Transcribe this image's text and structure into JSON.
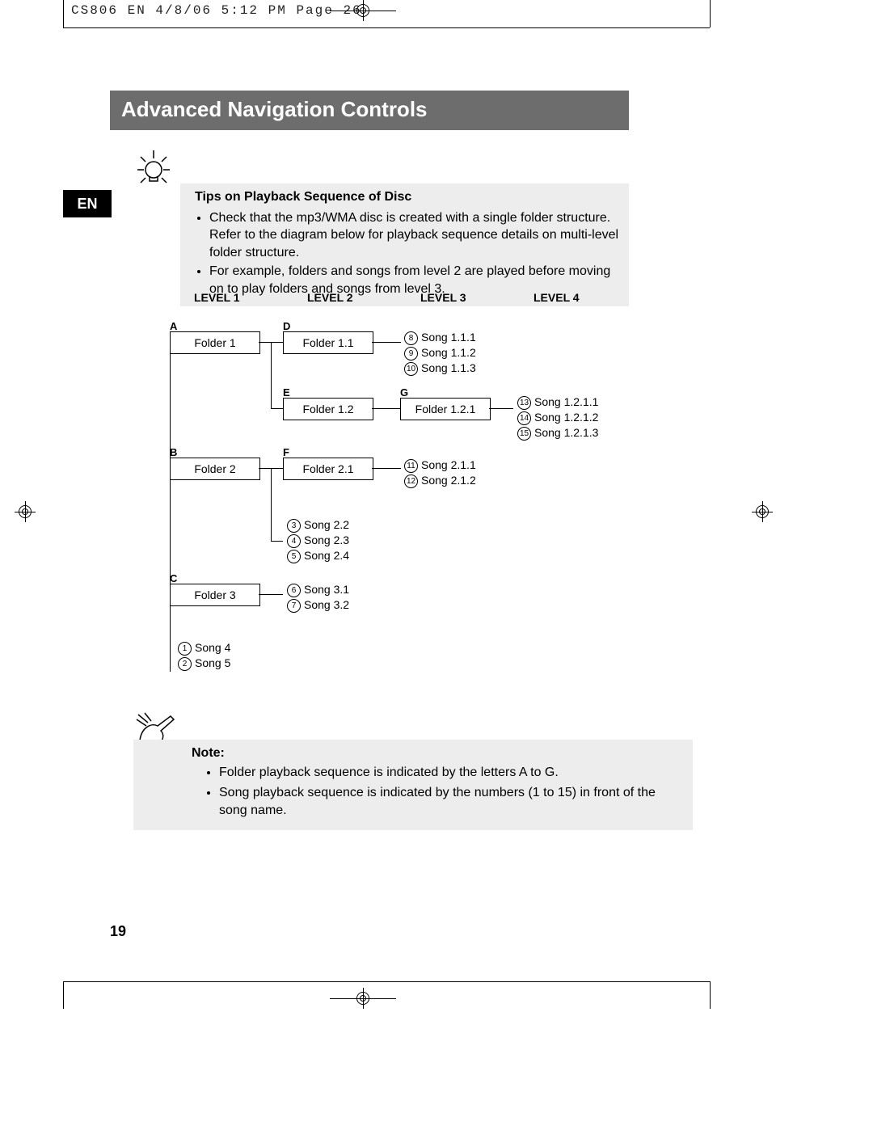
{
  "slug": "CS806 EN  4/8/06  5:12 PM  Page 26",
  "banner": "Advanced Navigation Controls",
  "lang": "EN",
  "tips": {
    "title": "Tips on Playback Sequence of Disc",
    "items": [
      "Check that the mp3/WMA disc is created with a single folder structure. Refer to the diagram below for playback sequence details on multi-level folder structure.",
      "For example, folders and songs from level 2 are played before moving on to play folders and songs from level 3."
    ]
  },
  "levels": [
    "LEVEL 1",
    "LEVEL 2",
    "LEVEL 3",
    "LEVEL 4"
  ],
  "folders": {
    "A": "Folder 1",
    "B": "Folder 2",
    "C": "Folder 3",
    "D": "Folder 1.1",
    "E": "Folder 1.2",
    "F": "Folder 2.1",
    "G": "Folder 1.2.1"
  },
  "songs": {
    "s111": {
      "n": "8",
      "t": "Song 1.1.1"
    },
    "s112": {
      "n": "9",
      "t": "Song 1.1.2"
    },
    "s113": {
      "n": "10",
      "t": "Song 1.1.3"
    },
    "s1211": {
      "n": "13",
      "t": "Song 1.2.1.1"
    },
    "s1212": {
      "n": "14",
      "t": "Song 1.2.1.2"
    },
    "s1213": {
      "n": "15",
      "t": "Song 1.2.1.3"
    },
    "s211": {
      "n": "11",
      "t": "Song 2.1.1"
    },
    "s212": {
      "n": "12",
      "t": "Song 2.1.2"
    },
    "s22": {
      "n": "3",
      "t": "Song 2.2"
    },
    "s23": {
      "n": "4",
      "t": "Song 2.3"
    },
    "s24": {
      "n": "5",
      "t": "Song 2.4"
    },
    "s31": {
      "n": "6",
      "t": "Song 3.1"
    },
    "s32": {
      "n": "7",
      "t": "Song 3.2"
    },
    "s4": {
      "n": "1",
      "t": "Song 4"
    },
    "s5": {
      "n": "2",
      "t": "Song 5"
    }
  },
  "note": {
    "title": "Note:",
    "items": [
      "Folder playback sequence is indicated by the letters A to G.",
      "Song playback sequence is indicated by the numbers (1 to 15) in front of the song name."
    ]
  },
  "page_number": "19",
  "flabels": {
    "A": "A",
    "B": "B",
    "C": "C",
    "D": "D",
    "E": "E",
    "F": "F",
    "G": "G"
  }
}
